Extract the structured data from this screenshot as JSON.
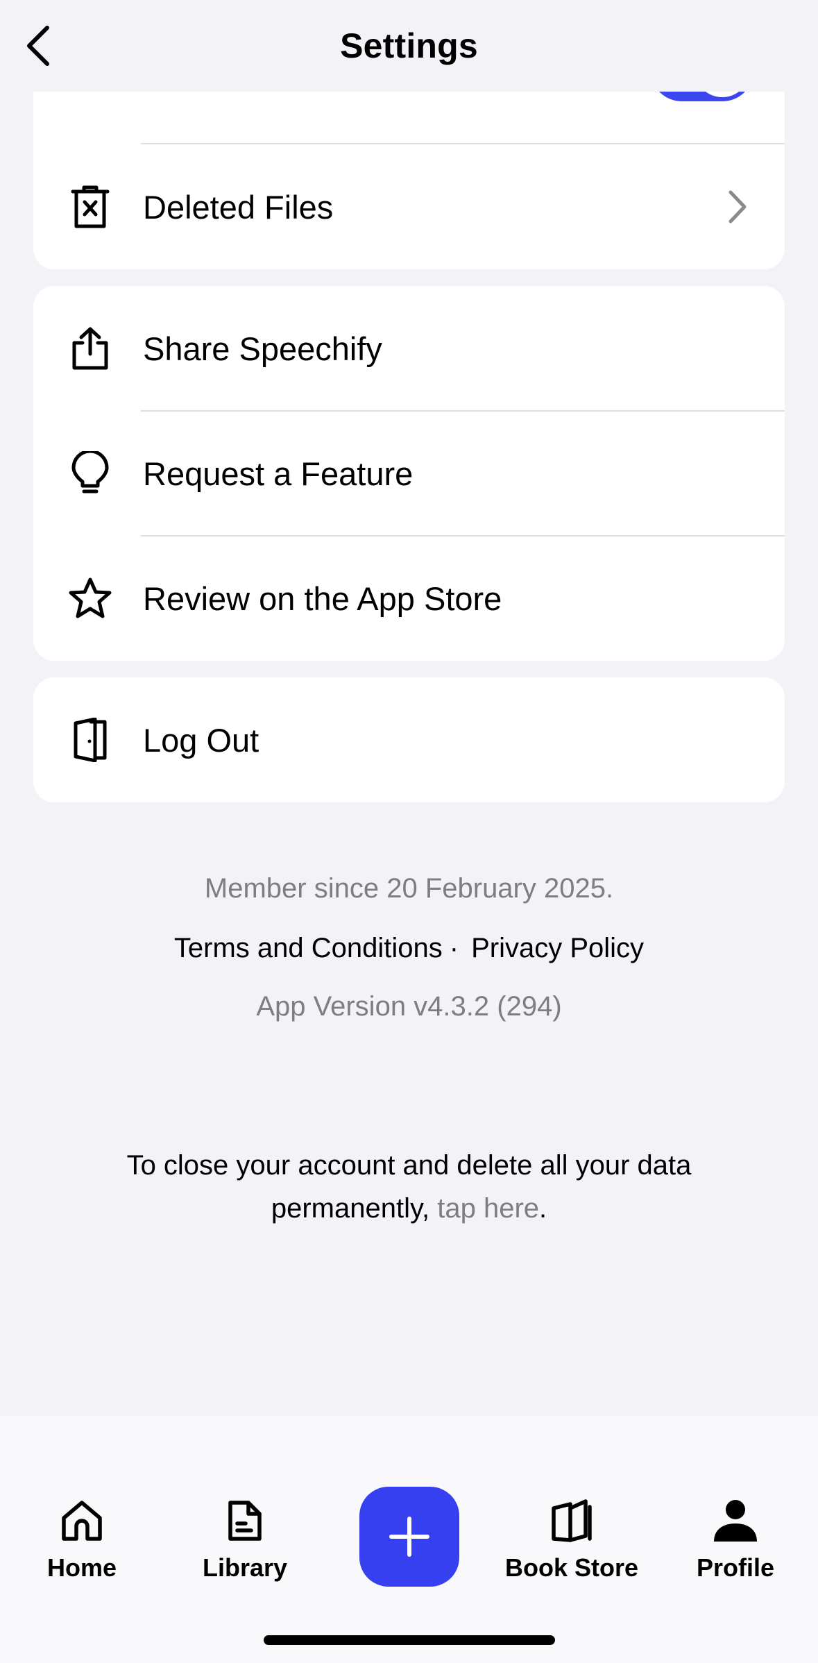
{
  "header": {
    "title": "Settings"
  },
  "card1": {
    "items": [
      {
        "label": "Deleted Files",
        "icon": "trash-x-icon"
      }
    ]
  },
  "card2": {
    "items": [
      {
        "label": "Share Speechify",
        "icon": "share-icon"
      },
      {
        "label": "Request a Feature",
        "icon": "lightbulb-icon"
      },
      {
        "label": "Review on the App Store",
        "icon": "star-icon"
      }
    ]
  },
  "card3": {
    "items": [
      {
        "label": "Log Out",
        "icon": "door-exit-icon"
      }
    ]
  },
  "footer": {
    "member_since": "Member since 20 February 2025.",
    "terms": "Terms and Conditions",
    "separator": "·",
    "privacy": "Privacy Policy",
    "version": "App Version v4.3.2 (294)",
    "close_account_text": "To close your account and delete all your data permanently,",
    "tap_here": "tap here",
    "period": "."
  },
  "tabbar": {
    "tabs": [
      {
        "label": "Home",
        "icon": "home-icon"
      },
      {
        "label": "Library",
        "icon": "document-icon"
      },
      {
        "label": "Book Store",
        "icon": "book-icon"
      },
      {
        "label": "Profile",
        "icon": "person-icon"
      }
    ]
  },
  "colors": {
    "accent": "#3740f0",
    "background": "#f2f2f7",
    "muted_text": "#7d7d84"
  }
}
